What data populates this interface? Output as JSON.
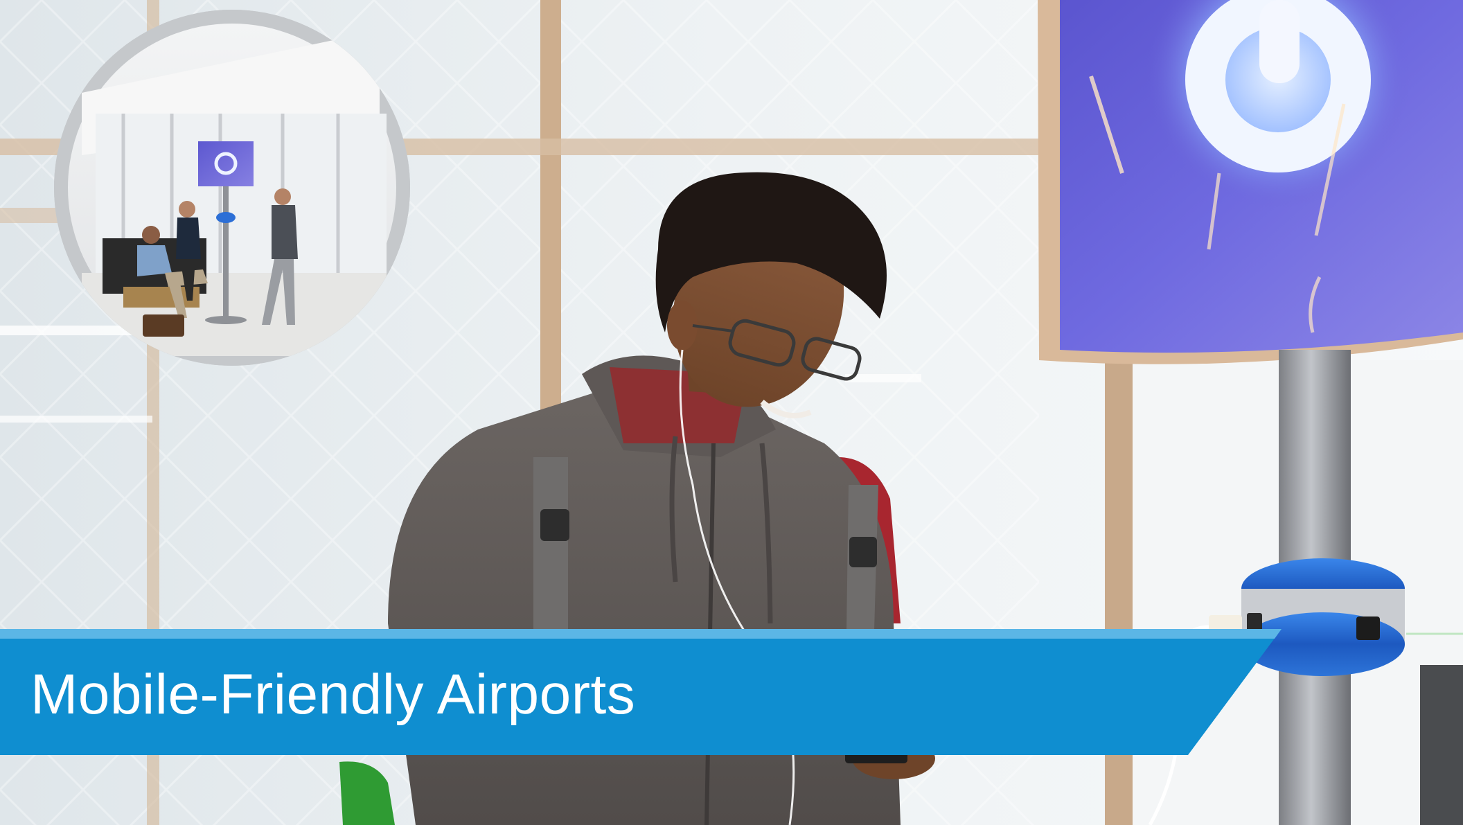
{
  "banner": {
    "title": "Mobile-Friendly Airports"
  },
  "colors": {
    "banner_fill": "#0f8ed0",
    "banner_highlight": "#5bb6e6",
    "kiosk_screen": "#6a63d8",
    "kiosk_glow": "#9cc4ff",
    "charger_base": "#2c6fd6",
    "window_frame": "#c9a887",
    "backpack_red": "#a8262f",
    "hoodie_grey": "#5f5a58"
  },
  "icons": {
    "kiosk_symbol": "power-icon"
  }
}
